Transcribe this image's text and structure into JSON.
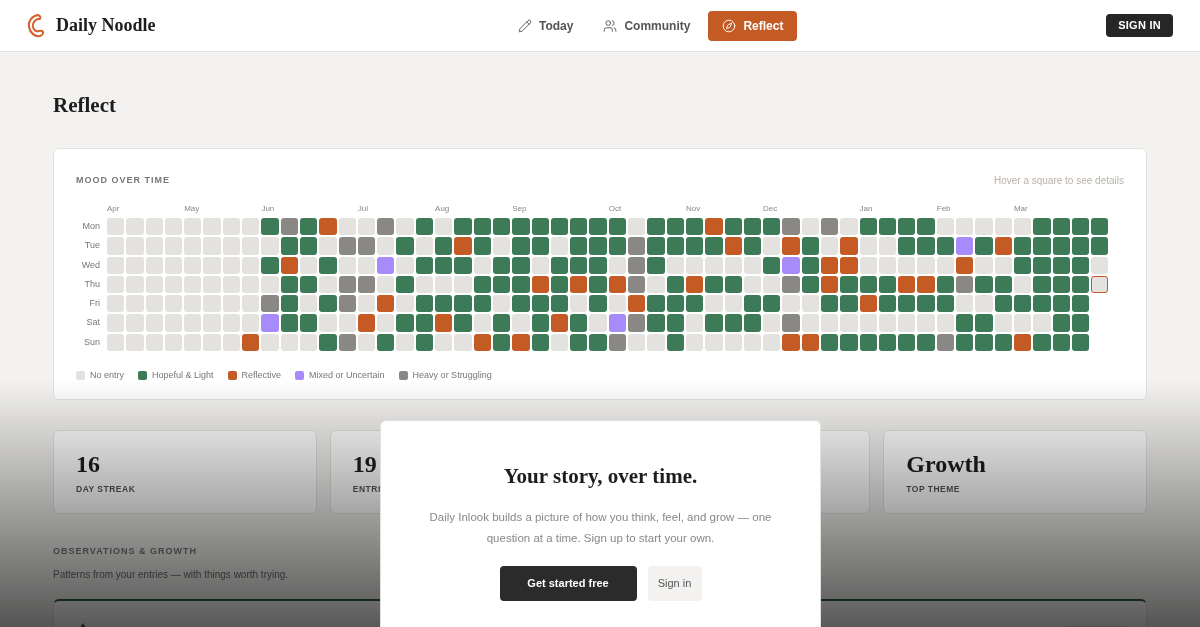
{
  "header": {
    "brand": "Daily Noodle",
    "nav": [
      {
        "label": "Today",
        "selected": false
      },
      {
        "label": "Community",
        "selected": false
      },
      {
        "label": "Reflect",
        "selected": true
      }
    ],
    "sign_in": "SIGN IN"
  },
  "page_title": "Reflect",
  "heatmap": {
    "title": "MOOD OVER TIME",
    "hint": "Hover a square to see details",
    "day_labels": [
      "Mon",
      "Tue",
      "Wed",
      "Thu",
      "Fri",
      "Sat",
      "Sun"
    ],
    "weeks": [
      {
        "month": "Apr",
        "days": [
          {
            "kind": "none"
          },
          {
            "kind": "none"
          },
          {
            "kind": "none"
          },
          {
            "kind": "none"
          },
          {
            "kind": "none"
          },
          {
            "kind": "none"
          },
          {
            "kind": "none"
          }
        ]
      },
      {
        "days": [
          {
            "kind": "none"
          },
          {
            "kind": "none"
          },
          {
            "kind": "none"
          },
          {
            "kind": "none"
          },
          {
            "kind": "none"
          },
          {
            "kind": "none"
          },
          {
            "kind": "none"
          }
        ]
      },
      {
        "days": [
          {
            "kind": "none"
          },
          {
            "kind": "none"
          },
          {
            "kind": "none"
          },
          {
            "kind": "none"
          },
          {
            "kind": "none"
          },
          {
            "kind": "none"
          },
          {
            "kind": "none"
          }
        ]
      },
      {
        "days": [
          {
            "kind": "none"
          },
          {
            "kind": "none"
          },
          {
            "kind": "none"
          },
          {
            "kind": "none"
          },
          {
            "kind": "none"
          },
          {
            "kind": "none"
          },
          {
            "kind": "none"
          }
        ]
      },
      {
        "month": "May",
        "days": [
          {
            "kind": "none"
          },
          {
            "kind": "none"
          },
          {
            "kind": "none"
          },
          {
            "kind": "none"
          },
          {
            "kind": "none"
          },
          {
            "kind": "none"
          },
          {
            "kind": "none"
          }
        ]
      },
      {
        "days": [
          {
            "kind": "none"
          },
          {
            "kind": "none"
          },
          {
            "kind": "none"
          },
          {
            "kind": "none"
          },
          {
            "kind": "none"
          },
          {
            "kind": "none"
          },
          {
            "kind": "none"
          }
        ]
      },
      {
        "days": [
          {
            "kind": "none"
          },
          {
            "kind": "none"
          },
          {
            "kind": "none"
          },
          {
            "kind": "none"
          },
          {
            "kind": "none"
          },
          {
            "kind": "none"
          },
          {
            "kind": "none"
          }
        ]
      },
      {
        "days": [
          {
            "kind": "none"
          },
          {
            "kind": "none"
          },
          {
            "kind": "none"
          },
          {
            "kind": "none"
          },
          {
            "kind": "none"
          },
          {
            "kind": "none"
          },
          {
            "kind": "reflective"
          }
        ]
      },
      {
        "month": "Jun",
        "days": [
          {
            "kind": "hopeful"
          },
          {
            "kind": "none"
          },
          {
            "kind": "hopeful"
          },
          {
            "kind": "none"
          },
          {
            "kind": "heavy"
          },
          {
            "kind": "mixed"
          },
          {
            "kind": "none"
          }
        ]
      },
      {
        "days": [
          {
            "kind": "heavy"
          },
          {
            "kind": "hopeful"
          },
          {
            "kind": "reflective"
          },
          {
            "kind": "hopeful"
          },
          {
            "kind": "hopeful"
          },
          {
            "kind": "hopeful"
          },
          {
            "kind": "none"
          }
        ]
      },
      {
        "days": [
          {
            "kind": "hopeful"
          },
          {
            "kind": "hopeful"
          },
          {
            "kind": "none"
          },
          {
            "kind": "hopeful"
          },
          {
            "kind": "none"
          },
          {
            "kind": "hopeful"
          },
          {
            "kind": "none"
          }
        ]
      },
      {
        "days": [
          {
            "kind": "reflective"
          },
          {
            "kind": "none"
          },
          {
            "kind": "hopeful"
          },
          {
            "kind": "none"
          },
          {
            "kind": "hopeful"
          },
          {
            "kind": "none"
          },
          {
            "kind": "hopeful"
          }
        ]
      },
      {
        "days": [
          {
            "kind": "none"
          },
          {
            "kind": "heavy"
          },
          {
            "kind": "none"
          },
          {
            "kind": "heavy"
          },
          {
            "kind": "heavy"
          },
          {
            "kind": "none"
          },
          {
            "kind": "heavy"
          }
        ]
      },
      {
        "month": "Jul",
        "days": [
          {
            "kind": "none"
          },
          {
            "kind": "heavy"
          },
          {
            "kind": "none"
          },
          {
            "kind": "heavy"
          },
          {
            "kind": "none"
          },
          {
            "kind": "reflective"
          },
          {
            "kind": "none"
          }
        ]
      },
      {
        "days": [
          {
            "kind": "heavy"
          },
          {
            "kind": "none"
          },
          {
            "kind": "mixed"
          },
          {
            "kind": "none"
          },
          {
            "kind": "reflective"
          },
          {
            "kind": "none"
          },
          {
            "kind": "hopeful"
          }
        ]
      },
      {
        "days": [
          {
            "kind": "none"
          },
          {
            "kind": "hopeful"
          },
          {
            "kind": "none"
          },
          {
            "kind": "hopeful"
          },
          {
            "kind": "none"
          },
          {
            "kind": "hopeful"
          },
          {
            "kind": "none"
          }
        ]
      },
      {
        "days": [
          {
            "kind": "hopeful"
          },
          {
            "kind": "none"
          },
          {
            "kind": "hopeful"
          },
          {
            "kind": "none"
          },
          {
            "kind": "hopeful"
          },
          {
            "kind": "hopeful"
          },
          {
            "kind": "hopeful"
          }
        ]
      },
      {
        "month": "Aug",
        "days": [
          {
            "kind": "none"
          },
          {
            "kind": "hopeful"
          },
          {
            "kind": "hopeful"
          },
          {
            "kind": "none"
          },
          {
            "kind": "hopeful"
          },
          {
            "kind": "reflective"
          },
          {
            "kind": "none"
          }
        ]
      },
      {
        "days": [
          {
            "kind": "hopeful"
          },
          {
            "kind": "reflective"
          },
          {
            "kind": "hopeful"
          },
          {
            "kind": "none"
          },
          {
            "kind": "hopeful"
          },
          {
            "kind": "hopeful"
          },
          {
            "kind": "none"
          }
        ]
      },
      {
        "days": [
          {
            "kind": "hopeful"
          },
          {
            "kind": "hopeful"
          },
          {
            "kind": "none"
          },
          {
            "kind": "hopeful"
          },
          {
            "kind": "hopeful"
          },
          {
            "kind": "none"
          },
          {
            "kind": "reflective"
          }
        ]
      },
      {
        "days": [
          {
            "kind": "hopeful"
          },
          {
            "kind": "none"
          },
          {
            "kind": "hopeful"
          },
          {
            "kind": "hopeful"
          },
          {
            "kind": "none"
          },
          {
            "kind": "hopeful"
          },
          {
            "kind": "hopeful"
          }
        ]
      },
      {
        "month": "Sep",
        "days": [
          {
            "kind": "hopeful"
          },
          {
            "kind": "hopeful"
          },
          {
            "kind": "hopeful"
          },
          {
            "kind": "hopeful"
          },
          {
            "kind": "hopeful"
          },
          {
            "kind": "none"
          },
          {
            "kind": "reflective"
          }
        ]
      },
      {
        "days": [
          {
            "kind": "hopeful"
          },
          {
            "kind": "hopeful"
          },
          {
            "kind": "none"
          },
          {
            "kind": "reflective"
          },
          {
            "kind": "hopeful"
          },
          {
            "kind": "hopeful"
          },
          {
            "kind": "hopeful"
          }
        ]
      },
      {
        "days": [
          {
            "kind": "hopeful"
          },
          {
            "kind": "none"
          },
          {
            "kind": "hopeful"
          },
          {
            "kind": "hopeful"
          },
          {
            "kind": "hopeful"
          },
          {
            "kind": "reflective"
          },
          {
            "kind": "none"
          }
        ]
      },
      {
        "days": [
          {
            "kind": "hopeful"
          },
          {
            "kind": "hopeful"
          },
          {
            "kind": "hopeful"
          },
          {
            "kind": "reflective"
          },
          {
            "kind": "none"
          },
          {
            "kind": "hopeful"
          },
          {
            "kind": "hopeful"
          }
        ]
      },
      {
        "days": [
          {
            "kind": "hopeful"
          },
          {
            "kind": "hopeful"
          },
          {
            "kind": "hopeful"
          },
          {
            "kind": "hopeful"
          },
          {
            "kind": "hopeful"
          },
          {
            "kind": "none"
          },
          {
            "kind": "hopeful"
          }
        ]
      },
      {
        "month": "Oct",
        "days": [
          {
            "kind": "hopeful"
          },
          {
            "kind": "hopeful"
          },
          {
            "kind": "none"
          },
          {
            "kind": "reflective"
          },
          {
            "kind": "none"
          },
          {
            "kind": "mixed"
          },
          {
            "kind": "heavy"
          }
        ]
      },
      {
        "days": [
          {
            "kind": "none"
          },
          {
            "kind": "heavy"
          },
          {
            "kind": "heavy"
          },
          {
            "kind": "heavy"
          },
          {
            "kind": "reflective"
          },
          {
            "kind": "heavy"
          },
          {
            "kind": "none"
          }
        ]
      },
      {
        "days": [
          {
            "kind": "hopeful"
          },
          {
            "kind": "hopeful"
          },
          {
            "kind": "hopeful"
          },
          {
            "kind": "none"
          },
          {
            "kind": "hopeful"
          },
          {
            "kind": "hopeful"
          },
          {
            "kind": "none"
          }
        ]
      },
      {
        "days": [
          {
            "kind": "hopeful"
          },
          {
            "kind": "hopeful"
          },
          {
            "kind": "none"
          },
          {
            "kind": "hopeful"
          },
          {
            "kind": "hopeful"
          },
          {
            "kind": "hopeful"
          },
          {
            "kind": "hopeful"
          }
        ]
      },
      {
        "month": "Nov",
        "days": [
          {
            "kind": "hopeful"
          },
          {
            "kind": "hopeful"
          },
          {
            "kind": "none"
          },
          {
            "kind": "reflective"
          },
          {
            "kind": "hopeful"
          },
          {
            "kind": "none"
          },
          {
            "kind": "none"
          }
        ]
      },
      {
        "days": [
          {
            "kind": "reflective"
          },
          {
            "kind": "hopeful"
          },
          {
            "kind": "none"
          },
          {
            "kind": "hopeful"
          },
          {
            "kind": "none"
          },
          {
            "kind": "hopeful"
          },
          {
            "kind": "none"
          }
        ]
      },
      {
        "days": [
          {
            "kind": "hopeful"
          },
          {
            "kind": "reflective"
          },
          {
            "kind": "none"
          },
          {
            "kind": "hopeful"
          },
          {
            "kind": "none"
          },
          {
            "kind": "hopeful"
          },
          {
            "kind": "none"
          }
        ]
      },
      {
        "days": [
          {
            "kind": "hopeful"
          },
          {
            "kind": "hopeful"
          },
          {
            "kind": "none"
          },
          {
            "kind": "none"
          },
          {
            "kind": "hopeful"
          },
          {
            "kind": "hopeful"
          },
          {
            "kind": "none"
          }
        ]
      },
      {
        "month": "Dec",
        "days": [
          {
            "kind": "hopeful"
          },
          {
            "kind": "none"
          },
          {
            "kind": "hopeful"
          },
          {
            "kind": "none"
          },
          {
            "kind": "hopeful"
          },
          {
            "kind": "none"
          },
          {
            "kind": "none"
          }
        ]
      },
      {
        "days": [
          {
            "kind": "heavy"
          },
          {
            "kind": "reflective"
          },
          {
            "kind": "mixed"
          },
          {
            "kind": "heavy"
          },
          {
            "kind": "none"
          },
          {
            "kind": "heavy"
          },
          {
            "kind": "reflective"
          }
        ]
      },
      {
        "days": [
          {
            "kind": "none"
          },
          {
            "kind": "hopeful"
          },
          {
            "kind": "hopeful"
          },
          {
            "kind": "hopeful"
          },
          {
            "kind": "none"
          },
          {
            "kind": "none"
          },
          {
            "kind": "reflective"
          }
        ]
      },
      {
        "days": [
          {
            "kind": "heavy"
          },
          {
            "kind": "none"
          },
          {
            "kind": "reflective"
          },
          {
            "kind": "reflective"
          },
          {
            "kind": "hopeful"
          },
          {
            "kind": "none"
          },
          {
            "kind": "hopeful"
          }
        ]
      },
      {
        "days": [
          {
            "kind": "none"
          },
          {
            "kind": "reflective"
          },
          {
            "kind": "reflective"
          },
          {
            "kind": "hopeful"
          },
          {
            "kind": "hopeful"
          },
          {
            "kind": "none"
          },
          {
            "kind": "hopeful"
          }
        ]
      },
      {
        "month": "Jan",
        "days": [
          {
            "kind": "hopeful"
          },
          {
            "kind": "none"
          },
          {
            "kind": "none"
          },
          {
            "kind": "hopeful"
          },
          {
            "kind": "reflective"
          },
          {
            "kind": "none"
          },
          {
            "kind": "hopeful"
          }
        ]
      },
      {
        "days": [
          {
            "kind": "hopeful"
          },
          {
            "kind": "none"
          },
          {
            "kind": "none"
          },
          {
            "kind": "hopeful"
          },
          {
            "kind": "hopeful"
          },
          {
            "kind": "none"
          },
          {
            "kind": "hopeful"
          }
        ]
      },
      {
        "days": [
          {
            "kind": "hopeful"
          },
          {
            "kind": "hopeful"
          },
          {
            "kind": "none"
          },
          {
            "kind": "reflective"
          },
          {
            "kind": "hopeful"
          },
          {
            "kind": "none"
          },
          {
            "kind": "hopeful"
          }
        ]
      },
      {
        "days": [
          {
            "kind": "hopeful"
          },
          {
            "kind": "hopeful"
          },
          {
            "kind": "none"
          },
          {
            "kind": "reflective"
          },
          {
            "kind": "hopeful"
          },
          {
            "kind": "none"
          },
          {
            "kind": "hopeful"
          }
        ]
      },
      {
        "month": "Feb",
        "days": [
          {
            "kind": "none"
          },
          {
            "kind": "hopeful"
          },
          {
            "kind": "none"
          },
          {
            "kind": "hopeful"
          },
          {
            "kind": "hopeful"
          },
          {
            "kind": "none"
          },
          {
            "kind": "heavy"
          }
        ]
      },
      {
        "days": [
          {
            "kind": "none"
          },
          {
            "kind": "mixed"
          },
          {
            "kind": "reflective"
          },
          {
            "kind": "heavy"
          },
          {
            "kind": "none"
          },
          {
            "kind": "hopeful"
          },
          {
            "kind": "hopeful"
          }
        ]
      },
      {
        "days": [
          {
            "kind": "none"
          },
          {
            "kind": "hopeful"
          },
          {
            "kind": "none"
          },
          {
            "kind": "hopeful"
          },
          {
            "kind": "none"
          },
          {
            "kind": "hopeful"
          },
          {
            "kind": "hopeful"
          }
        ]
      },
      {
        "days": [
          {
            "kind": "none"
          },
          {
            "kind": "reflective"
          },
          {
            "kind": "none"
          },
          {
            "kind": "hopeful"
          },
          {
            "kind": "hopeful"
          },
          {
            "kind": "none"
          },
          {
            "kind": "hopeful"
          }
        ]
      },
      {
        "month": "Mar",
        "days": [
          {
            "kind": "none"
          },
          {
            "kind": "hopeful"
          },
          {
            "kind": "hopeful"
          },
          {
            "kind": "none"
          },
          {
            "kind": "hopeful"
          },
          {
            "kind": "none"
          },
          {
            "kind": "reflective"
          }
        ]
      },
      {
        "days": [
          {
            "kind": "hopeful"
          },
          {
            "kind": "hopeful"
          },
          {
            "kind": "hopeful"
          },
          {
            "kind": "hopeful"
          },
          {
            "kind": "hopeful"
          },
          {
            "kind": "none"
          },
          {
            "kind": "hopeful"
          }
        ]
      },
      {
        "days": [
          {
            "kind": "hopeful"
          },
          {
            "kind": "hopeful"
          },
          {
            "kind": "hopeful"
          },
          {
            "kind": "hopeful"
          },
          {
            "kind": "hopeful"
          },
          {
            "kind": "hopeful"
          },
          {
            "kind": "hopeful"
          }
        ]
      },
      {
        "days": [
          {
            "kind": "hopeful"
          },
          {
            "kind": "hopeful"
          },
          {
            "kind": "hopeful"
          },
          {
            "kind": "hopeful"
          },
          {
            "kind": "hopeful"
          },
          {
            "kind": "hopeful"
          },
          {
            "kind": "hopeful"
          }
        ]
      },
      {
        "days": [
          {
            "kind": "hopeful"
          },
          {
            "kind": "hopeful"
          },
          {
            "kind": "none"
          },
          {
            "kind": "today"
          }
        ]
      }
    ],
    "legend": [
      {
        "kind": "none",
        "label": "No entry",
        "color": "#e4e2df"
      },
      {
        "kind": "hopeful",
        "label": "Hopeful & Light",
        "color": "#3d7a58"
      },
      {
        "kind": "reflective",
        "label": "Reflective",
        "color": "#c45a24"
      },
      {
        "kind": "mixed",
        "label": "Mixed or Uncertain",
        "color": "#a78bfa"
      },
      {
        "kind": "heavy",
        "label": "Heavy or Struggling",
        "color": "#8a8884"
      }
    ]
  },
  "stats": [
    {
      "value": "16",
      "label": "DAY STREAK"
    },
    {
      "value": "19",
      "label": "ENTRI"
    },
    {
      "value": "Growth",
      "label": "TOP THEME"
    }
  ],
  "observations": {
    "heading": "OBSERVATIONS & GROWTH",
    "subtitle": "Patterns from your entries — with things worth trying."
  },
  "modal": {
    "title": "Your story, over time.",
    "text": "Daily Inlook builds a picture of how you think, feel, and grow — one question at a time. Sign up to start your own.",
    "primary": "Get started free",
    "secondary": "Sign in"
  }
}
